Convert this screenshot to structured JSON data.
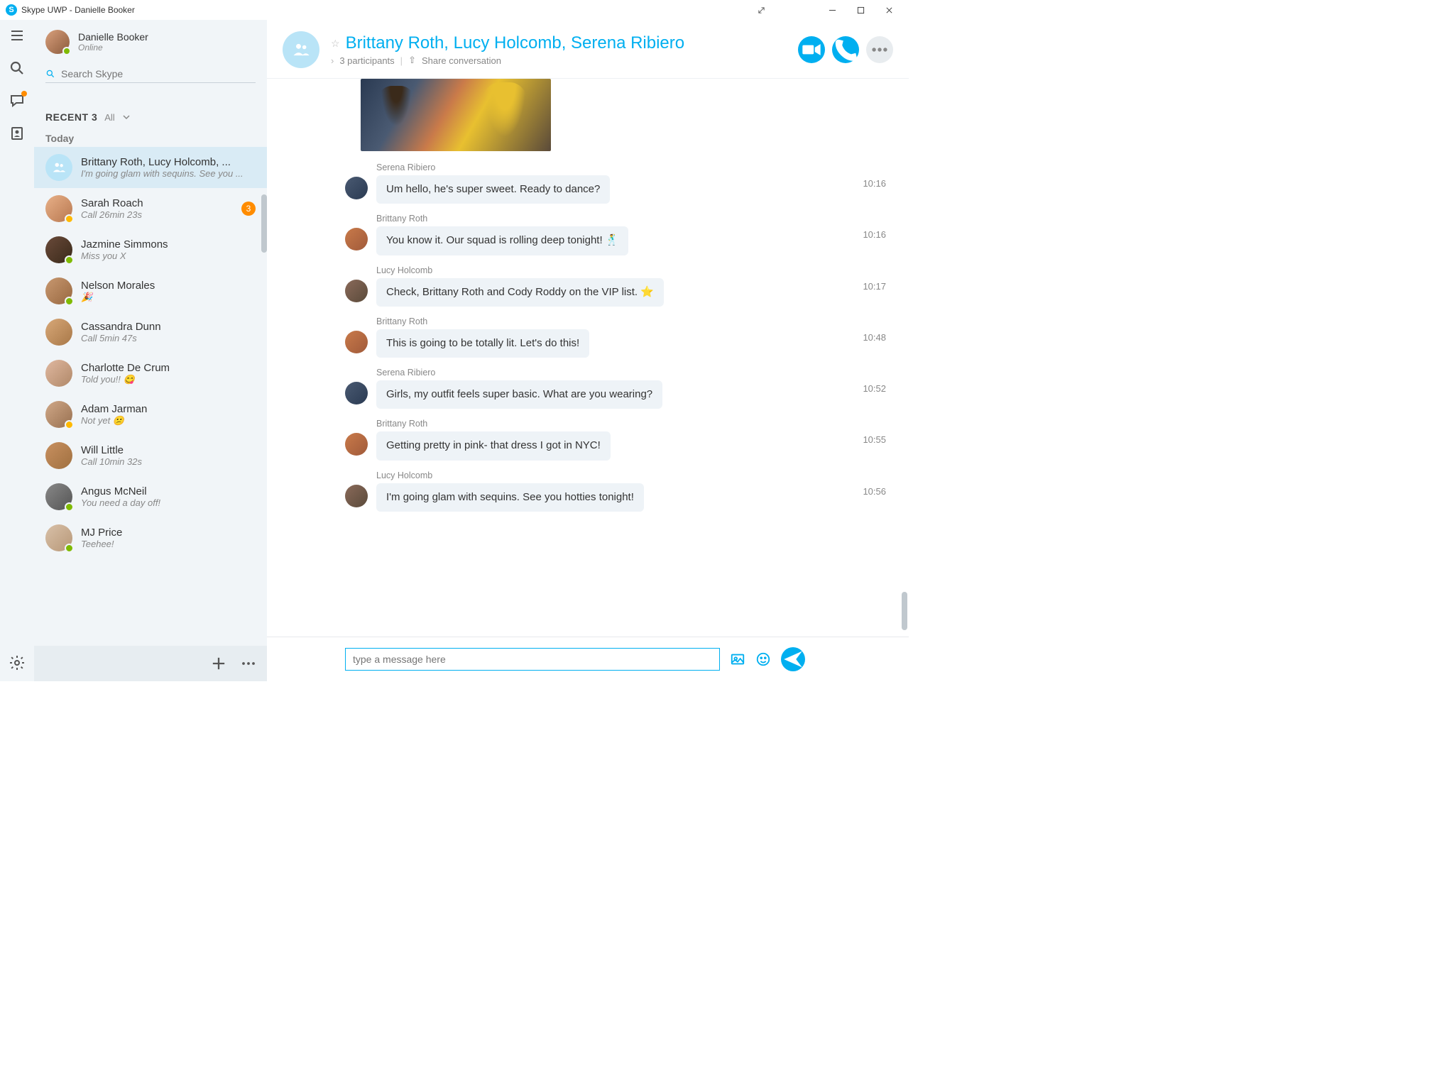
{
  "window": {
    "title": "Skype UWP - Danielle Booker"
  },
  "profile": {
    "name": "Danielle Booker",
    "status": "Online"
  },
  "search": {
    "placeholder": "Search Skype"
  },
  "recent": {
    "heading": "RECENT 3",
    "filter": "All",
    "day": "Today"
  },
  "conversations": [
    {
      "title": "Brittany Roth, Lucy Holcomb, ...",
      "subtitle": "I'm going glam with sequins. See you ...",
      "type": "group",
      "selected": true,
      "presence": "",
      "badge": ""
    },
    {
      "title": "Sarah Roach",
      "subtitle": "Call 26min 23s",
      "type": "person",
      "avclass": "av1",
      "presence": "away",
      "badge": "3"
    },
    {
      "title": "Jazmine Simmons",
      "subtitle": "Miss you X",
      "type": "person",
      "avclass": "av2",
      "presence": "online",
      "badge": ""
    },
    {
      "title": "Nelson Morales",
      "subtitle": "🎉",
      "type": "person",
      "avclass": "av3",
      "presence": "online",
      "badge": ""
    },
    {
      "title": "Cassandra Dunn",
      "subtitle": "Call 5min 47s",
      "type": "person",
      "avclass": "av4",
      "presence": "",
      "badge": ""
    },
    {
      "title": "Charlotte De Crum",
      "subtitle": "Told you!! 😋",
      "type": "person",
      "avclass": "av5",
      "presence": "",
      "badge": ""
    },
    {
      "title": "Adam Jarman",
      "subtitle": "Not yet 😕",
      "type": "person",
      "avclass": "av6",
      "presence": "away",
      "badge": ""
    },
    {
      "title": "Will Little",
      "subtitle": "Call 10min 32s",
      "type": "person",
      "avclass": "av7",
      "presence": "",
      "badge": ""
    },
    {
      "title": "Angus McNeil",
      "subtitle": "You need a day off!",
      "type": "person",
      "avclass": "av8",
      "presence": "online",
      "badge": ""
    },
    {
      "title": "MJ Price",
      "subtitle": "Teehee!",
      "type": "person",
      "avclass": "av9",
      "presence": "online",
      "badge": ""
    }
  ],
  "chat": {
    "title": "Brittany Roth, Lucy Holcomb, Serena Ribiero",
    "participants": "3 participants",
    "share": "Share conversation"
  },
  "messages": [
    {
      "sender": "Serena Ribiero",
      "text": "Um hello, he's super sweet. Ready to dance?",
      "time": "10:16",
      "avclass": "avS"
    },
    {
      "sender": "Brittany Roth",
      "text": "You know it. Our squad is rolling deep tonight! 🕺",
      "time": "10:16",
      "avclass": "avB"
    },
    {
      "sender": "Lucy Holcomb",
      "text": "Check, Brittany Roth and Cody Roddy on the VIP list. ⭐",
      "time": "10:17",
      "avclass": "avL"
    },
    {
      "sender": "Brittany Roth",
      "text": "This is going to be totally lit. Let's do this!",
      "time": "10:48",
      "avclass": "avB"
    },
    {
      "sender": "Serena Ribiero",
      "text": "Girls, my outfit feels super basic. What are you wearing?",
      "time": "10:52",
      "avclass": "avS"
    },
    {
      "sender": "Brittany Roth",
      "text": "Getting pretty in pink- that dress I got in NYC!",
      "time": "10:55",
      "avclass": "avB"
    },
    {
      "sender": "Lucy Holcomb",
      "text": "I'm going glam with sequins. See you hotties tonight!",
      "time": "10:56",
      "avclass": "avL"
    }
  ],
  "composer": {
    "placeholder": "type a message here"
  }
}
